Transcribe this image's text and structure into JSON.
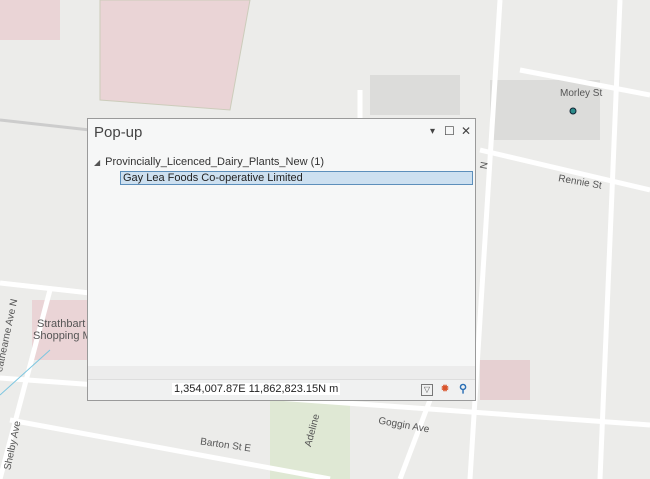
{
  "map": {
    "labels": {
      "morley": "Morley St",
      "rennie": "Rennie St",
      "mall": "Strathbart",
      "mall2": "Shopping M",
      "strathearne": "eathearne Ave N",
      "shelby": "Shelby Ave",
      "barton": "Barton St E",
      "goggin": "Goggin Ave",
      "adeline": "Adeline",
      "n": "N"
    }
  },
  "popup": {
    "title": "Pop-up",
    "controls": {
      "menu": "▾",
      "maximize": "☐",
      "close": "✕"
    },
    "layer": "Provincially_Licenced_Dairy_Plants_New  (1)",
    "feature": "Gay Lea Foods Co-operative Limited",
    "coordinates": "1,354,007.87E 11,862,823.15N m",
    "icons": [
      "filter-icon",
      "flash-icon",
      "zoom-to-icon"
    ]
  }
}
